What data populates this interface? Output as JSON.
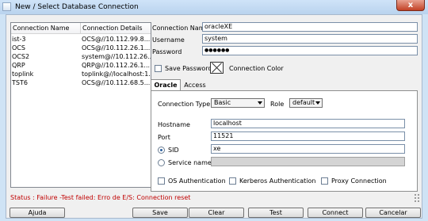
{
  "window": {
    "title": "New / Select Database Connection",
    "close_label": "x"
  },
  "table": {
    "headers": [
      "Connection Name",
      "Connection Details"
    ],
    "rows": [
      [
        "ist-3",
        "OCS@//10.112.99.8..."
      ],
      [
        "OCS",
        "OCS@//10.112.26.1..."
      ],
      [
        "OCS2",
        "system@//10.112.26..."
      ],
      [
        "QRP",
        "QRP@//10.112.26.1..."
      ],
      [
        "toplink",
        "toplink@//localhost:1..."
      ],
      [
        "TST6",
        "OCS@//10.112.68.5..."
      ]
    ]
  },
  "form": {
    "connection_name_label": "Connection Name",
    "connection_name_value": "oracleXE",
    "username_label": "Username",
    "username_value": "system",
    "password_label": "Password",
    "password_value": "●●●●●●",
    "save_password_label": "Save Password",
    "connection_color_label": "Connection Color"
  },
  "tabs": {
    "oracle": "Oracle",
    "access": "Access"
  },
  "oracle_tab": {
    "connection_type_label": "Connection Type",
    "connection_type_value": "Basic",
    "role_label": "Role",
    "role_value": "default",
    "hostname_label": "Hostname",
    "hostname_value": "localhost",
    "port_label": "Port",
    "port_value": "11521",
    "sid_label": "SID",
    "sid_value": "xe",
    "service_name_label": "Service name",
    "service_name_value": "",
    "os_auth_label": "OS Authentication",
    "kerberos_label": "Kerberos Authentication",
    "proxy_label": "Proxy Connection"
  },
  "status": {
    "text": "Status : Failure -Test failed: Erro de E/S: Connection reset",
    "color": "#c00000"
  },
  "buttons": {
    "help": "Ajuda",
    "save": "Save",
    "clear": "Clear",
    "test": "Test",
    "connect": "Connect",
    "cancel": "Cancelar"
  }
}
